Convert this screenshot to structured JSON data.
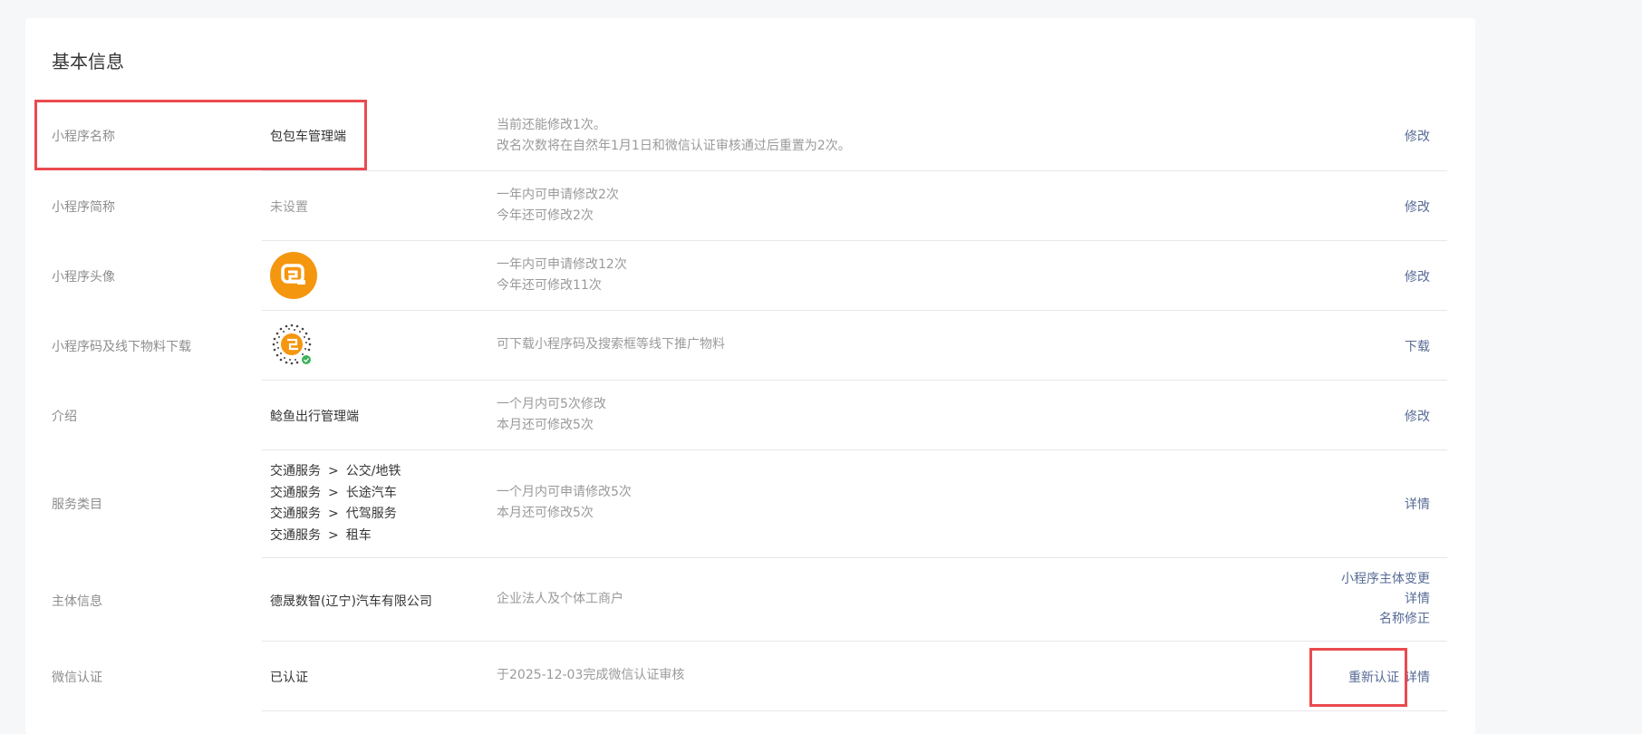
{
  "section": {
    "title": "基本信息"
  },
  "rows": {
    "name": {
      "label": "小程序名称",
      "value": "包包车管理端",
      "desc1": "当前还能修改1次。",
      "desc2": "改名次数将在自然年1月1日和微信认证审核通过后重置为2次。",
      "action": "修改"
    },
    "short_name": {
      "label": "小程序简称",
      "value": "未设置",
      "desc1": "一年内可申请修改2次",
      "desc2": "今年还可修改2次",
      "action": "修改"
    },
    "avatar": {
      "label": "小程序头像",
      "desc1": "一年内可申请修改12次",
      "desc2": "今年还可修改11次",
      "action": "修改"
    },
    "qrcode": {
      "label": "小程序码及线下物料下载",
      "desc1": "可下载小程序码及搜索框等线下推广物料",
      "action": "下载"
    },
    "intro": {
      "label": "介绍",
      "value": "鲶鱼出行管理端",
      "desc1": "一个月内可5次修改",
      "desc2": "本月还可修改5次",
      "action": "修改"
    },
    "category": {
      "label": "服务类目",
      "items": [
        {
          "main": "交通服务",
          "sep": ">",
          "sub": "公交/地铁"
        },
        {
          "main": "交通服务",
          "sep": ">",
          "sub": "长途汽车"
        },
        {
          "main": "交通服务",
          "sep": ">",
          "sub": "代驾服务"
        },
        {
          "main": "交通服务",
          "sep": ">",
          "sub": "租车"
        }
      ],
      "desc1": "一个月内可申请修改5次",
      "desc2": "本月还可修改5次",
      "action": "详情"
    },
    "subject": {
      "label": "主体信息",
      "value": "德晟数智(辽宁)汽车有限公司",
      "desc1": "企业法人及个体工商户",
      "action1": "小程序主体变更",
      "action2": "详情",
      "action3": "名称修正"
    },
    "wechat_auth": {
      "label": "微信认证",
      "value": "已认证",
      "desc1": "于2025-12-03完成微信认证审核",
      "action1": "重新认证",
      "action2": "详情"
    }
  },
  "colors": {
    "link": "#576b95",
    "highlight": "#ea4a4f",
    "avatar_bg": "#f5960f"
  }
}
